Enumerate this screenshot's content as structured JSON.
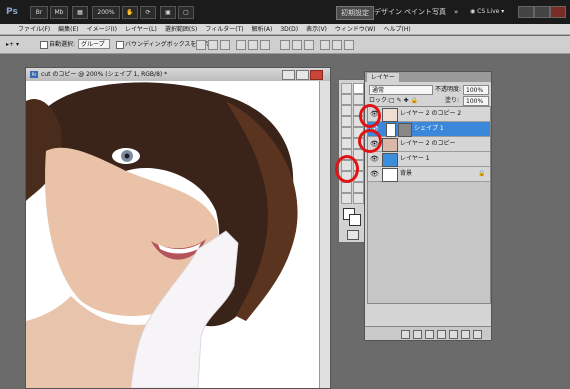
{
  "app": {
    "logo": "Ps",
    "zoom": "200%"
  },
  "workspaces": {
    "active": "初期設定",
    "items": [
      "デザイン",
      "ペイント",
      "写真"
    ],
    "more": "»"
  },
  "cslive": {
    "label": "CS Live"
  },
  "menu": [
    "ファイル(F)",
    "編集(E)",
    "イメージ(I)",
    "レイヤー(L)",
    "選択範囲(S)",
    "フィルター(T)",
    "解析(A)",
    "3D(D)",
    "表示(V)",
    "ウィンドウ(W)",
    "ヘルプ(H)"
  ],
  "options": {
    "auto_select_label": "自動選択:",
    "auto_select_value": "グループ",
    "bbox_label": "バウンディングボックスを表示"
  },
  "document": {
    "title": "cut のコピー @ 200% (シェイプ 1, RGB/8) *"
  },
  "layers_panel": {
    "tab": "レイヤー",
    "blend_mode": "通常",
    "opacity_label": "不透明度:",
    "opacity_value": "100%",
    "lock_label": "ロック:",
    "fill_label": "塗り:",
    "fill_value": "100%",
    "layers": [
      {
        "name": "レイヤー 2 のコピー 2",
        "selected": false
      },
      {
        "name": "シェイプ 1",
        "selected": true
      },
      {
        "name": "レイヤー 2 のコピー",
        "selected": false
      },
      {
        "name": "レイヤー 1",
        "selected": false
      },
      {
        "name": "背景",
        "selected": false
      }
    ]
  },
  "colors": {
    "highlight": "#3b87d9",
    "annotation": "#e01414",
    "titlebar": "#1b1b1b"
  }
}
